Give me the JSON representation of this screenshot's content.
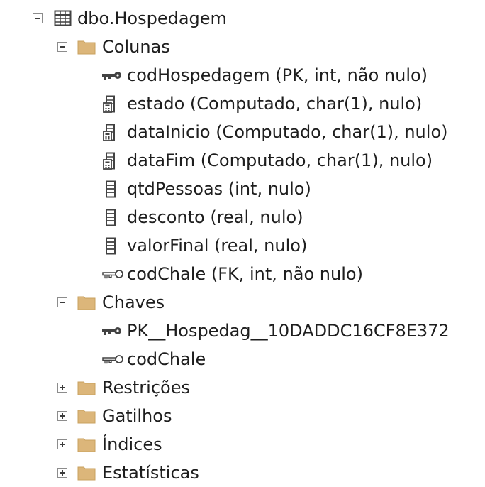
{
  "tree": {
    "table_label": "dbo.Hospedagem",
    "colunas_folder": "Colunas",
    "columns": [
      {
        "label": "codHospedagem (PK, int, não nulo)",
        "icon": "primary-key-icon"
      },
      {
        "label": "estado (Computado, char(1), nulo)",
        "icon": "computed-column-icon"
      },
      {
        "label": "dataInicio (Computado, char(1), nulo)",
        "icon": "computed-column-icon"
      },
      {
        "label": "dataFim (Computado, char(1), nulo)",
        "icon": "computed-column-icon"
      },
      {
        "label": "qtdPessoas (int, nulo)",
        "icon": "column-icon"
      },
      {
        "label": "desconto (real, nulo)",
        "icon": "column-icon"
      },
      {
        "label": "valorFinal (real, nulo)",
        "icon": "column-icon"
      },
      {
        "label": "codChale (FK, int, não nulo)",
        "icon": "foreign-key-icon"
      }
    ],
    "chaves_folder": "Chaves",
    "keys": [
      {
        "label": "PK__Hospedag__10DADDC16CF8E372",
        "icon": "primary-key-icon"
      },
      {
        "label": "codChale",
        "icon": "foreign-key-icon"
      }
    ],
    "restricoes_folder": "Restrições",
    "gatilhos_folder": "Gatilhos",
    "indices_folder": "Índices",
    "estatisticas_folder": "Estatísticas"
  },
  "colors": {
    "folder": "#dcb67a",
    "folder_dark": "#c9a15f",
    "icon_stroke": "#424242",
    "text": "#1e1e1e"
  }
}
